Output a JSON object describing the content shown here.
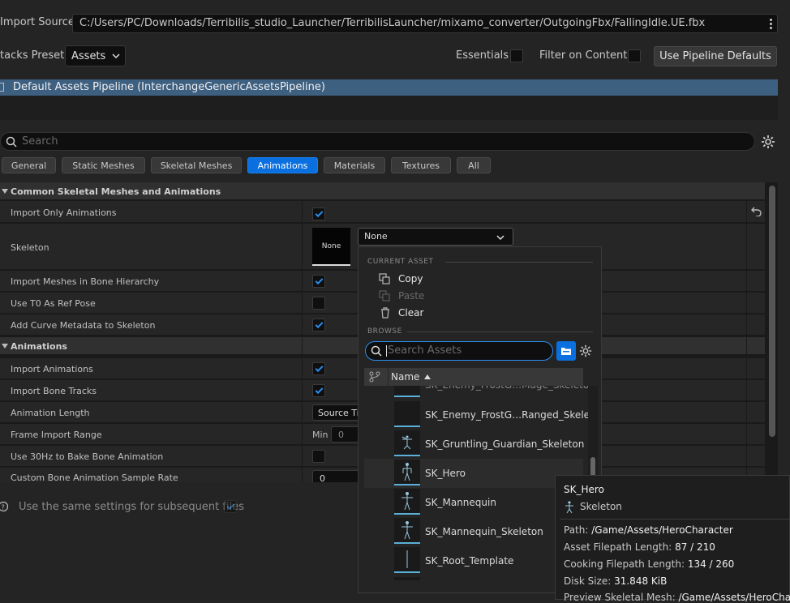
{
  "import_source": {
    "label": "Import Source",
    "path": "C:/Users/PC/Downloads/Terribilis_studio_Launcher/TerribilisLauncher/mixamo_converter/OutgoingFbx/FallingIdle.UE.fbx"
  },
  "stacks_preset": {
    "label": "tacks Preset",
    "value": "Assets"
  },
  "toggles": {
    "essentials": "Essentials",
    "filter_on_contents": "Filter on Contents",
    "use_pipeline_defaults": "Use Pipeline Defaults"
  },
  "pipeline": {
    "label": "Default Assets Pipeline (InterchangeGenericAssetsPipeline)"
  },
  "search": {
    "placeholder": "Search"
  },
  "tabs": [
    "General",
    "Static Meshes",
    "Skeletal Meshes",
    "Animations",
    "Materials",
    "Textures",
    "All"
  ],
  "active_tab": "Animations",
  "categories": {
    "common": "Common Skeletal Meshes and Animations",
    "animations": "Animations"
  },
  "properties": {
    "import_only_animations": "Import Only Animations",
    "skeleton": "Skeleton",
    "skeleton_thumb": "None",
    "skeleton_value": "None",
    "import_meshes_bone_hierarchy": "Import Meshes in Bone Hierarchy",
    "use_t0_ref_pose": "Use T0 As Ref Pose",
    "add_curve_metadata": "Add Curve Metadata to Skeleton",
    "import_animations": "Import Animations",
    "import_bone_tracks": "Import Bone Tracks",
    "animation_length": "Animation Length",
    "animation_length_value": "Source Ti",
    "frame_import_range": "Frame Import Range",
    "frame_min_label": "Min",
    "frame_min_value": "0",
    "use_30hz": "Use 30Hz to Bake Bone Animation",
    "custom_sample_rate": "Custom Bone Animation Sample Rate",
    "custom_sample_rate_value": "0"
  },
  "footer": {
    "same_settings": "Use the same settings for subsequent files"
  },
  "dropdown": {
    "current_asset_header": "CURRENT ASSET",
    "copy": "Copy",
    "paste": "Paste",
    "clear": "Clear",
    "browse_header": "BROWSE",
    "search_placeholder": "Search Assets",
    "name_column": "Name",
    "assets": [
      "SK_Enemy_FrostG…Ranged_Skeleton",
      "SK_Gruntling_Guardian_Skeleton",
      "SK_Hero",
      "SK_Mannequin",
      "SK_Mannequin_Skeleton",
      "SK_Root_Template"
    ]
  },
  "tooltip": {
    "title": "SK_Hero",
    "type": "Skeleton",
    "path_label": "Path:",
    "path_value": "/Game/Assets/HeroCharacter",
    "afl_label": "Asset Filepath Length:",
    "afl_value": "87 / 210",
    "cfl_label": "Cooking Filepath Length:",
    "cfl_value": "134 / 260",
    "disk_label": "Disk Size:",
    "disk_value": "31.848 KiB",
    "preview_label": "Preview Skeletal Mesh:",
    "preview_value": "/Game/Assets/HeroCharacter"
  },
  "colors": {
    "accent": "#0a70e0",
    "selection_band": "#3d5f80",
    "background": "#242424"
  }
}
